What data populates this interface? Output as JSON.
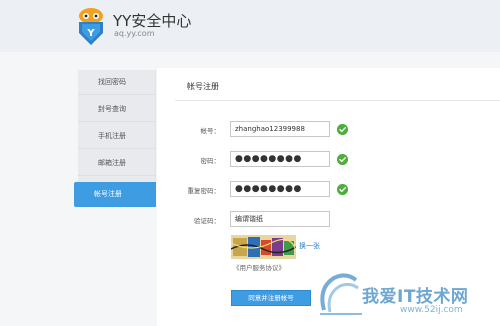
{
  "header": {
    "title": "YY安全中心",
    "domain": "aq.yy.com",
    "logo_letter": "Y"
  },
  "sidebar": {
    "items": [
      {
        "label": "找回密码",
        "active": false
      },
      {
        "label": "封号查询",
        "active": false
      },
      {
        "label": "手机注册",
        "active": false
      },
      {
        "label": "邮箱注册",
        "active": false
      },
      {
        "label": "帐号注册",
        "active": true
      }
    ]
  },
  "form": {
    "title": "帐号注册",
    "account": {
      "label": "帐号：",
      "value": "zhanghao12399988",
      "valid": true
    },
    "password": {
      "label": "密码：",
      "value": "●●●●●●●●",
      "valid": true
    },
    "confirm_password": {
      "label": "重复密码：",
      "value": "●●●●●●●●",
      "valid": true
    },
    "captcha": {
      "label": "验证码：",
      "value": "编谓谐纸"
    },
    "refresh_label": "换一张",
    "agreement_label": "《用户服务协议》",
    "submit_label": "同意并注册帐号"
  },
  "watermark": {
    "text": "我爱IT技术网",
    "url": "www.52ij.com"
  },
  "colors": {
    "accent": "#3e9ce2",
    "check": "#4caf3c",
    "link": "#2b7fd0"
  }
}
